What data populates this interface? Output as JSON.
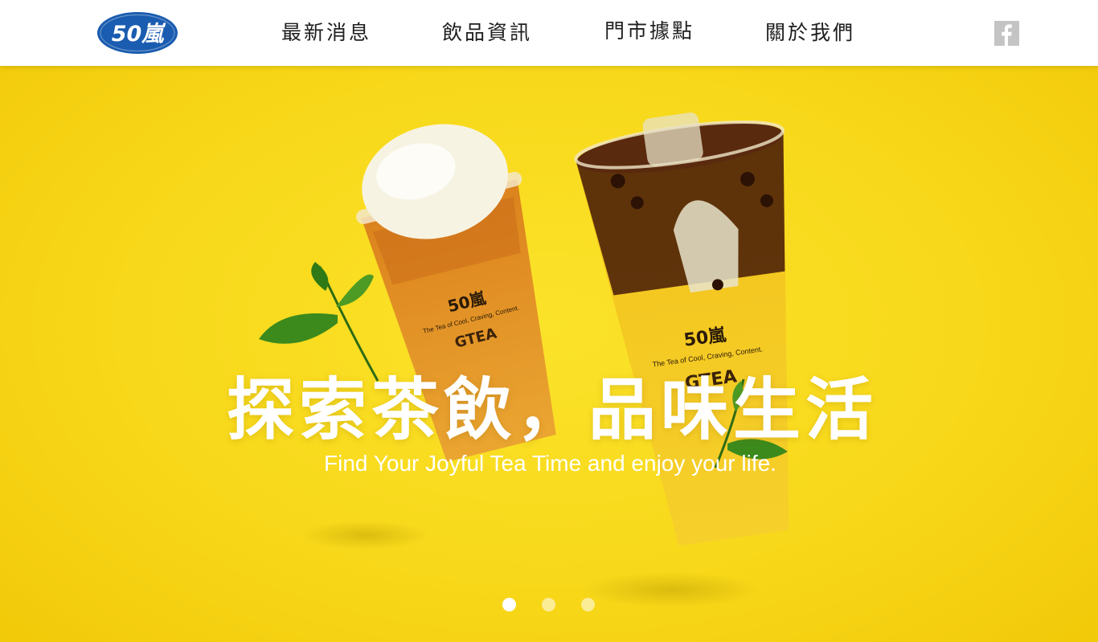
{
  "header": {
    "logo_text": "50嵐",
    "nav": [
      {
        "label": "最新消息"
      },
      {
        "label": "飲品資訊"
      },
      {
        "label": "門市據點"
      },
      {
        "label": "關於我們"
      }
    ],
    "social_icon": "facebook-icon"
  },
  "hero": {
    "title": "探索茶飲，品味生活",
    "subtitle": "Find Your Joyful Tea Time and enjoy your life.",
    "cup_texts": {
      "brand": "50嵐",
      "tagline": "The Tea of Cool, Craving, Content.",
      "mark": "GTEA"
    },
    "carousel": {
      "slide_count": 3,
      "active_slide": 1
    }
  },
  "colors": {
    "hero_yellow": "#f8d81a",
    "logo_blue": "#1a5cb0",
    "nav_text": "#1e1e1e",
    "facebook_gray": "#c4c4c4"
  }
}
